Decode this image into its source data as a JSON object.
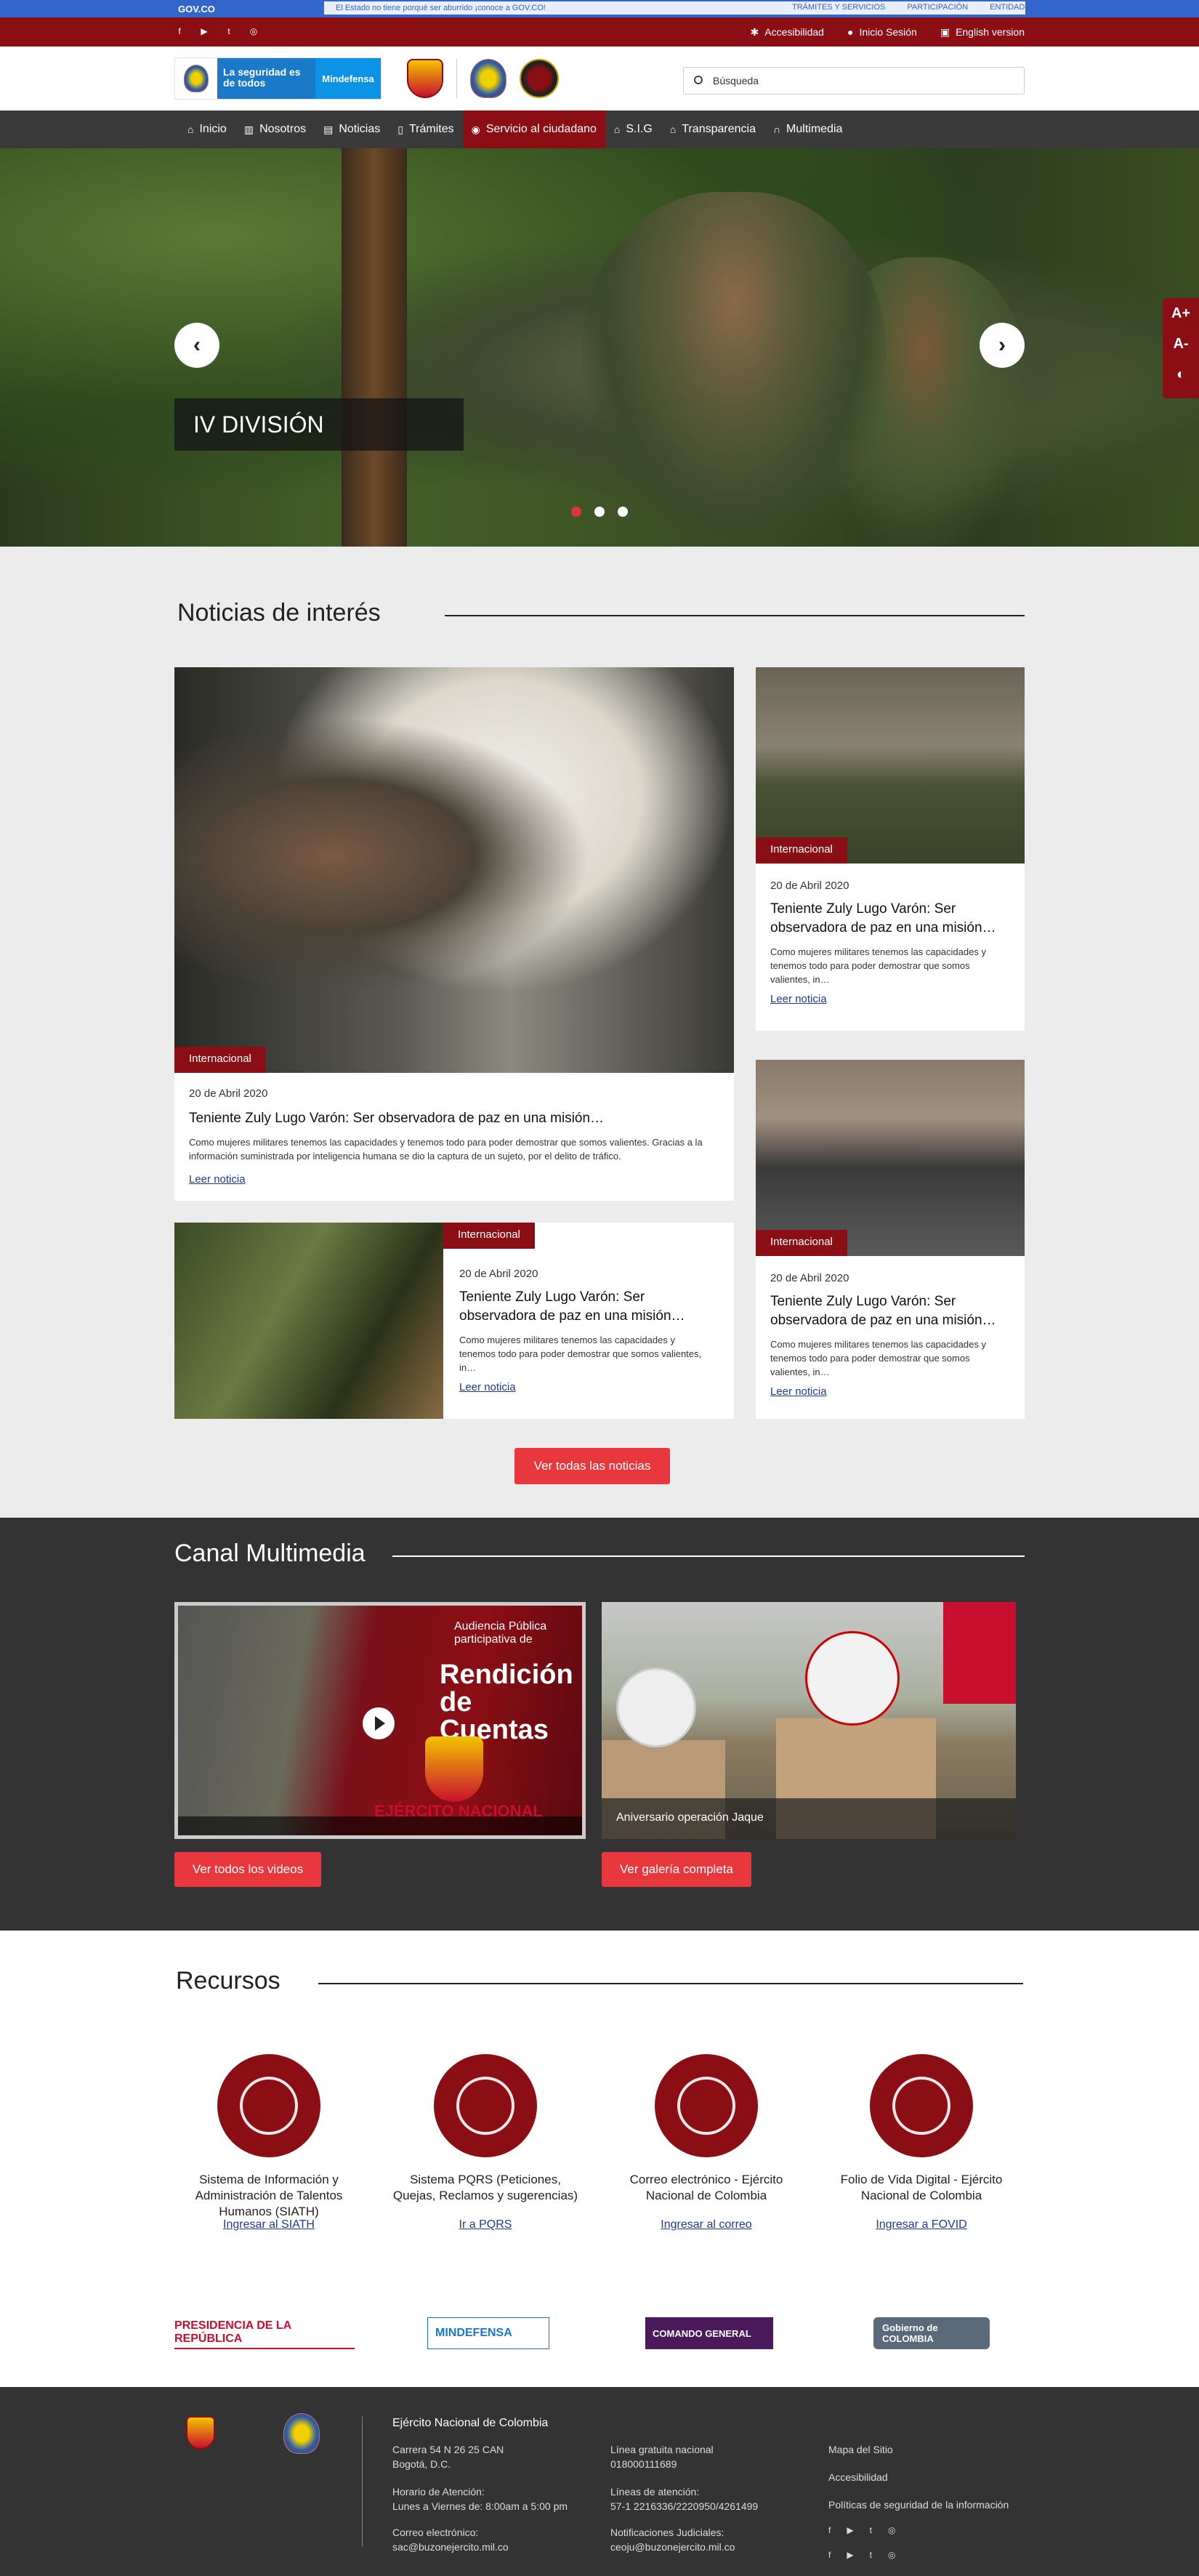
{
  "gov": {
    "logo": "GOV.CO",
    "notice": "El Estado no tiene porqué ser aburrido ¡conoce a GOV.CO!",
    "links": [
      "TRÁMITES Y SERVICIOS",
      "PARTICIPACIÓN",
      "ENTIDADES"
    ]
  },
  "util": {
    "accessibility": "Accesibilidad",
    "login": "Inicio Sesión",
    "english": "English version"
  },
  "header": {
    "tagline": "La seguridad es de todos",
    "ministry": "Mindefensa",
    "search_placeholder": "Búsqueda"
  },
  "nav": {
    "items": [
      "Inicio",
      "Nosotros",
      "Noticias",
      "Trámites",
      "Servicio al ciudadano",
      "S.I.G",
      "Transparencia",
      "Multimedia"
    ],
    "active": "Servicio al ciudadano"
  },
  "hero": {
    "caption": "IV DIVISIÓN",
    "slides": 3,
    "active_slide": 1
  },
  "side_tools": [
    "A+",
    "A-",
    "◐"
  ],
  "news": {
    "title": "Noticias de interés",
    "featured": {
      "tag": "Internacional",
      "date": "20 de Abril 2020",
      "title": "Teniente Zuly Lugo Varón: Ser observadora de paz en una misión…",
      "desc": "Como mujeres militares tenemos las capacidades y tenemos todo para poder demostrar que somos valientes. Gracias a la información suministrada por inteligencia humana se dio la captura de un sujeto, por el delito de tráfico.",
      "more": "Leer noticia"
    },
    "side1": {
      "tag": "Internacional",
      "date": "20 de Abril 2020",
      "title": "Teniente Zuly Lugo Varón: Ser observadora de paz en una misión…",
      "desc": "Como mujeres militares tenemos las capacidades y tenemos todo para poder demostrar que somos valientes, in…",
      "more": "Leer noticia"
    },
    "wide": {
      "tag": "Internacional",
      "date": "20 de Abril 2020",
      "title": "Teniente Zuly Lugo Varón: Ser observadora de paz en una misión…",
      "desc": "Como mujeres militares tenemos las capacidades y tenemos todo para poder demostrar que somos valientes, in…",
      "more": "Leer noticia"
    },
    "side2": {
      "tag": "Internacional",
      "date": "20 de Abril 2020",
      "title": "Teniente Zuly Lugo Varón: Ser observadora de paz en una misión…",
      "desc": "Como mujeres militares tenemos las capacidades y tenemos todo para poder demostrar que somos valientes, in…",
      "more": "Leer noticia"
    },
    "all_button": "Ver todas las noticias"
  },
  "multimedia": {
    "title": "Canal Multimedia",
    "video": {
      "line1": "Audiencia Pública participativa de",
      "line2": "Rendición de Cuentas",
      "brand": "EJÉRCITO NACIONAL"
    },
    "photo_caption": "Aniversario operación Jaque",
    "videos_button": "Ver todos los videos",
    "gallery_button": "Ver galería completa"
  },
  "resources": {
    "title": "Recursos",
    "items": [
      {
        "name": "Sistema de Información y Administración de Talentos Humanos (SIATH)",
        "link": "Ingresar al SIATH"
      },
      {
        "name": "Sistema PQRS (Peticiones, Quejas, Reclamos y sugerencias)",
        "link": "Ir a PQRS"
      },
      {
        "name": "Correo electrónico - Ejército Nacional de Colombia",
        "link": "Ingresar al correo"
      },
      {
        "name": "Folio de Vida Digital - Ejército Nacional de Colombia",
        "link": "Ingresar a FOVID"
      }
    ]
  },
  "partners": [
    "PRESIDENCIA DE LA REPÚBLICA",
    "MINDEFENSA",
    "COMANDO GENERAL",
    "Gobierno de COLOMBIA"
  ],
  "footer": {
    "org": "Ejército Nacional de Colombia",
    "address": [
      "Carrera 54 N 26 25 CAN",
      "Bogotá, D.C."
    ],
    "hours_label": "Horario de Atención:",
    "hours": "Lunes a Viernes de: 8:00am a 5:00 pm",
    "email_label": "Correo electrónico:",
    "email": "sac@buzonejercito.mil.co",
    "free_line_label": "Línea gratuita nacional",
    "free_line": "018000111689",
    "lines_label": "Líneas de atención:",
    "lines": "57-1 2216336/2220950/4261499",
    "judicial_label": "Notificaciones Judiciales:",
    "judicial": "ceoju@buzonejercito.mil.co",
    "links": [
      "Mapa del Sitio",
      "Accesibilidad",
      "Políticas de seguridad de la información"
    ]
  },
  "colors": {
    "gov_blue": "#3366cc",
    "brand_red": "#8b0e14",
    "button_red": "#e8383e",
    "nav_dark": "#3a3a3a"
  }
}
